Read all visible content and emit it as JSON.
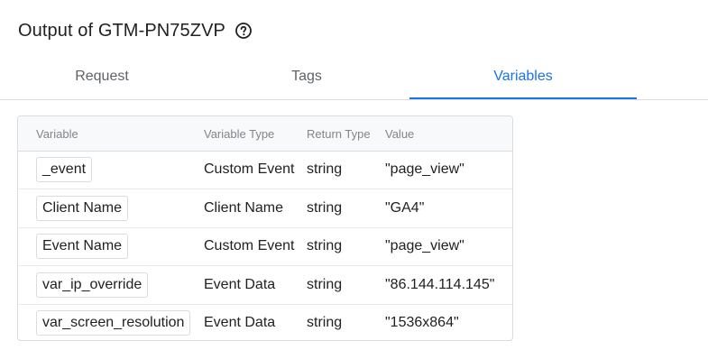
{
  "header": {
    "title": "Output of GTM-PN75ZVP",
    "help_icon": "help-circle-icon"
  },
  "tabs": [
    {
      "label": "Request",
      "active": false
    },
    {
      "label": "Tags",
      "active": false
    },
    {
      "label": "Variables",
      "active": true
    }
  ],
  "colors": {
    "accent": "#1a73e8",
    "text": "#202124",
    "muted": "#5f6368",
    "border": "#dadce0"
  },
  "table": {
    "columns": [
      "Variable",
      "Variable Type",
      "Return Type",
      "Value"
    ],
    "rows": [
      {
        "variable": "_event",
        "variable_type": "Custom Event",
        "return_type": "string",
        "value": "\"page_view\""
      },
      {
        "variable": "Client Name",
        "variable_type": "Client Name",
        "return_type": "string",
        "value": "\"GA4\""
      },
      {
        "variable": "Event Name",
        "variable_type": "Custom Event",
        "return_type": "string",
        "value": "\"page_view\""
      },
      {
        "variable": "var_ip_override",
        "variable_type": "Event Data",
        "return_type": "string",
        "value": "\"86.144.114.145\""
      },
      {
        "variable": "var_screen_resolution",
        "variable_type": "Event Data",
        "return_type": "string",
        "value": "\"1536x864\""
      }
    ]
  }
}
